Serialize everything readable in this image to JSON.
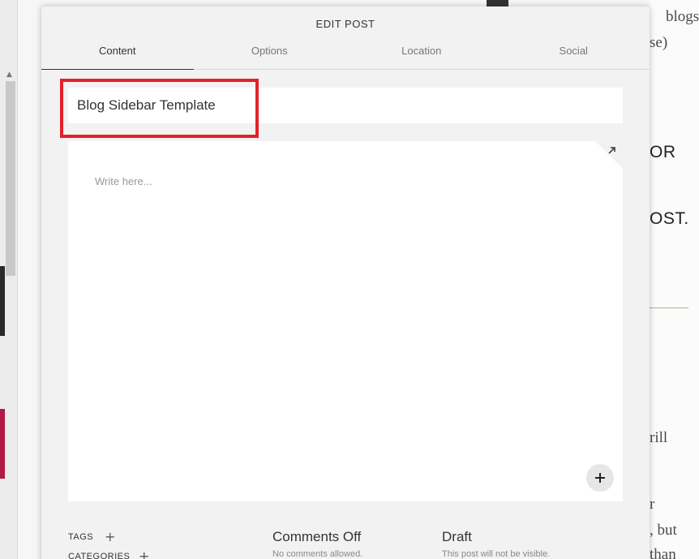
{
  "modal": {
    "title": "EDIT POST",
    "tabs": [
      {
        "label": "Content",
        "active": true
      },
      {
        "label": "Options",
        "active": false
      },
      {
        "label": "Location",
        "active": false
      },
      {
        "label": "Social",
        "active": false
      }
    ],
    "post_title_value": "Blog Sidebar Template",
    "editor_placeholder": "Write here...",
    "tags_label": "TAGS",
    "categories_label": "CATEGORIES",
    "comments": {
      "heading": "Comments Off",
      "sub": "No comments allowed."
    },
    "status": {
      "heading": "Draft",
      "sub": "This post will not be visible."
    }
  },
  "background_page": {
    "text_fragments": [
      "blogs",
      "se)",
      "OR",
      "OST.",
      "rill",
      "r",
      ", but",
      "than"
    ]
  },
  "colors": {
    "highlight": "#e3202b",
    "rule": "#c9a98a"
  }
}
